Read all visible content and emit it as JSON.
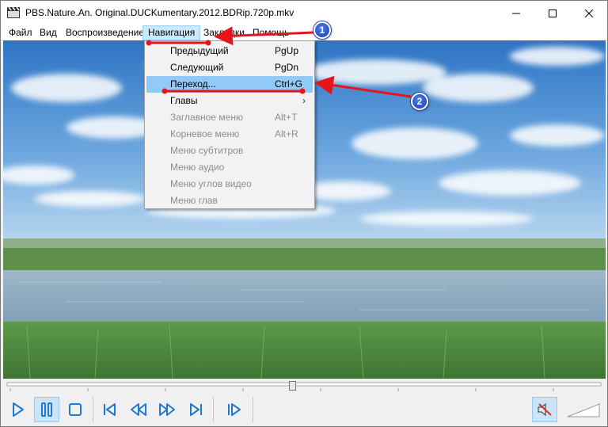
{
  "window": {
    "title": "PBS.Nature.An. Original.DUCKumentary.2012.BDRip.720p.mkv",
    "app_icon": "clapperboard-icon",
    "minimize_icon": "minimize-icon",
    "maximize_icon": "maximize-icon",
    "close_icon": "close-icon"
  },
  "menubar": {
    "items": [
      {
        "label": "Файл"
      },
      {
        "label": "Вид"
      },
      {
        "label": "Воспроизведение"
      },
      {
        "label": "Навигация"
      },
      {
        "label": "Закладки"
      },
      {
        "label": "Помощь"
      }
    ],
    "active_index": 3
  },
  "navigation_menu": {
    "items": [
      {
        "label": "Предыдущий",
        "shortcut": "PgUp",
        "disabled": false
      },
      {
        "label": "Следующий",
        "shortcut": "PgDn",
        "disabled": false
      },
      {
        "label": "Переход...",
        "shortcut": "Ctrl+G",
        "disabled": false,
        "highlighted": true
      },
      {
        "label": "Главы",
        "shortcut": "",
        "disabled": false,
        "submenu": true
      },
      {
        "label": "Заглавное меню",
        "shortcut": "Alt+T",
        "disabled": true
      },
      {
        "label": "Корневое меню",
        "shortcut": "Alt+R",
        "disabled": true
      },
      {
        "label": "Меню субтитров",
        "shortcut": "",
        "disabled": true
      },
      {
        "label": "Меню аудио",
        "shortcut": "",
        "disabled": true
      },
      {
        "label": "Меню углов видео",
        "shortcut": "",
        "disabled": true
      },
      {
        "label": "Меню глав",
        "shortcut": "",
        "disabled": true
      }
    ]
  },
  "annotations": [
    {
      "number": "1"
    },
    {
      "number": "2"
    }
  ],
  "controls": {
    "seek_position": 0.48,
    "volume_muted": true,
    "buttons": [
      "play-icon",
      "pause-icon",
      "stop-icon",
      "frame-back-icon",
      "rewind-icon",
      "fast-forward-icon",
      "frame-forward-icon",
      "frame-step-icon",
      "mute-icon"
    ]
  },
  "colors": {
    "menu_highlight": "#91c9f7",
    "annotation_red": "#e8141c",
    "badge_blue": "#1a3fa8"
  }
}
